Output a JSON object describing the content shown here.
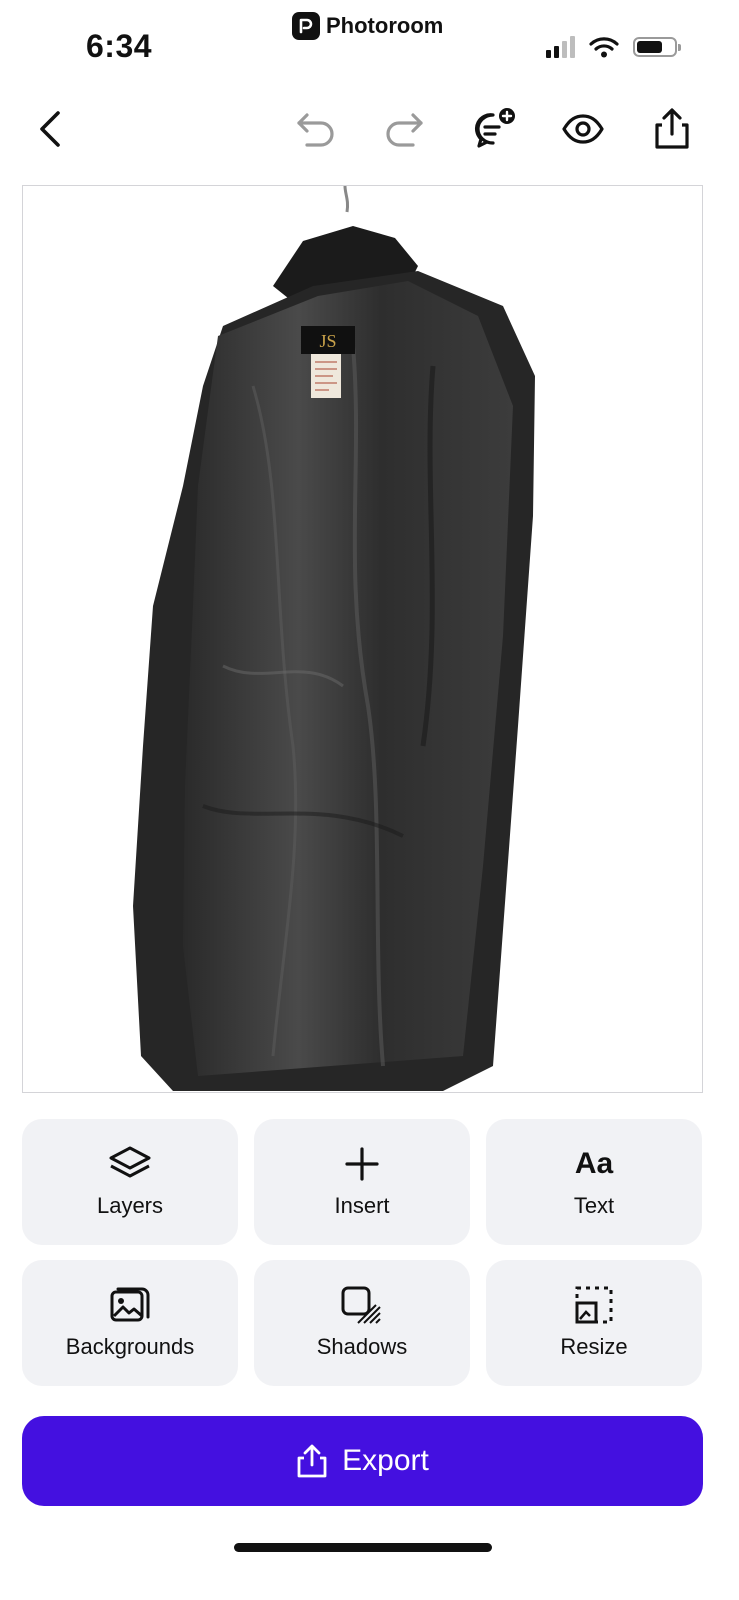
{
  "status_bar": {
    "time": "6:34",
    "app_name": "Photoroom",
    "cellular_bars": 2,
    "battery_level": 0.6
  },
  "toolbar": {
    "back_icon": "chevron-left-icon",
    "undo_icon": "undo-icon",
    "redo_icon": "redo-icon",
    "feedback_icon": "chat-plus-icon",
    "preview_icon": "eye-icon",
    "share_icon": "share-icon"
  },
  "canvas": {
    "subject": "black coat interior with lining on hanger",
    "label_brand": "JS",
    "label_sub": "BOUTIQUE"
  },
  "tools": [
    {
      "label": "Layers",
      "icon": "layers-icon"
    },
    {
      "label": "Insert",
      "icon": "plus-icon"
    },
    {
      "label": "Text",
      "icon": "text-icon",
      "glyph": "Aa"
    },
    {
      "label": "Backgrounds",
      "icon": "image-stack-icon"
    },
    {
      "label": "Shadows",
      "icon": "shadow-icon"
    },
    {
      "label": "Resize",
      "icon": "resize-icon"
    }
  ],
  "export": {
    "label": "Export",
    "icon": "share-icon"
  },
  "colors": {
    "accent": "#4410e0",
    "tile_bg": "#f1f2f5"
  }
}
